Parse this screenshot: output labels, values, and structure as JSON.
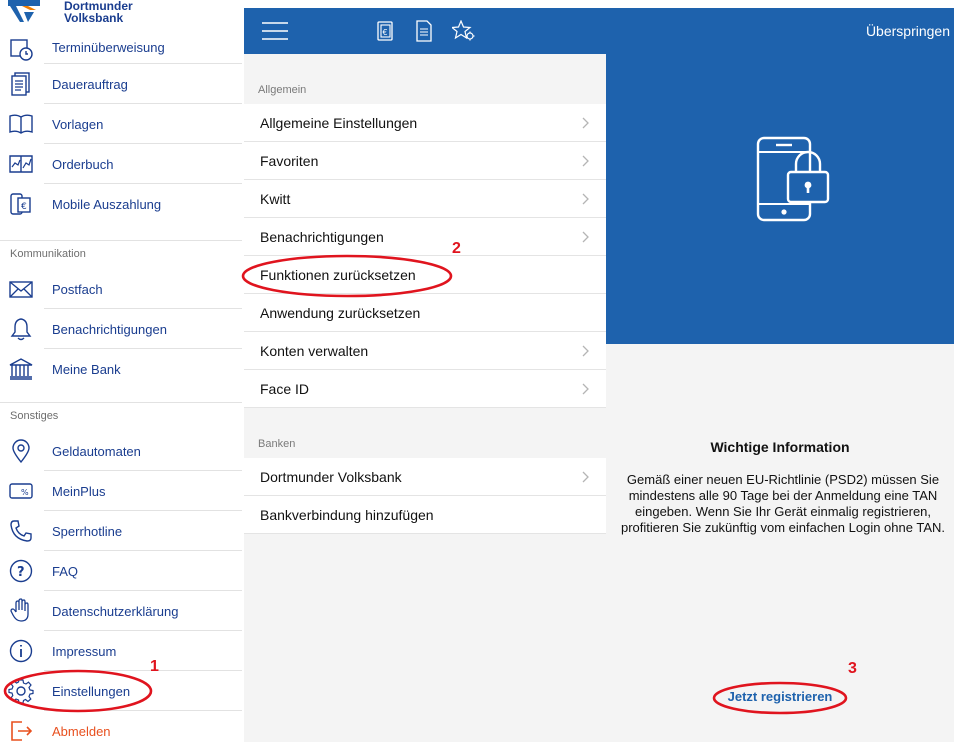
{
  "brand": {
    "line1": "Dortmunder",
    "line2": "Volksbank"
  },
  "sidebar": {
    "items_top": [
      {
        "label": "Terminüberweisung",
        "icon": "calendar-clock-icon"
      },
      {
        "label": "Dauerauftrag",
        "icon": "document-stack-icon"
      },
      {
        "label": "Vorlagen",
        "icon": "open-book-icon"
      },
      {
        "label": "Orderbuch",
        "icon": "chart-book-icon"
      },
      {
        "label": "Mobile Auszahlung",
        "icon": "phone-euro-icon"
      }
    ],
    "section_kommunikation": "Kommunikation",
    "items_komm": [
      {
        "label": "Postfach",
        "icon": "envelope-icon"
      },
      {
        "label": "Benachrichtigungen",
        "icon": "bell-icon"
      },
      {
        "label": "Meine Bank",
        "icon": "bank-building-icon"
      }
    ],
    "section_sonstiges": "Sonstiges",
    "items_sonst": [
      {
        "label": "Geldautomaten",
        "icon": "map-pin-icon"
      },
      {
        "label": "MeinPlus",
        "icon": "percent-card-icon"
      },
      {
        "label": "Sperrhotline",
        "icon": "phone-handset-icon"
      },
      {
        "label": "FAQ",
        "icon": "question-circle-icon"
      },
      {
        "label": "Datenschutzerklärung",
        "icon": "hand-icon"
      },
      {
        "label": "Impressum",
        "icon": "info-circle-icon"
      },
      {
        "label": "Einstellungen",
        "icon": "gear-icon"
      },
      {
        "label": "Abmelden",
        "icon": "logout-icon"
      }
    ]
  },
  "topbar": {
    "skip_label": "Überspringen"
  },
  "settings": {
    "section_allgemein": "Allgemein",
    "allgemein": [
      {
        "label": "Allgemeine Einstellungen",
        "chevron": true
      },
      {
        "label": "Favoriten",
        "chevron": true
      },
      {
        "label": "Kwitt",
        "chevron": true
      },
      {
        "label": "Benachrichtigungen",
        "chevron": true
      },
      {
        "label": "Funktionen zurücksetzen",
        "chevron": false
      },
      {
        "label": "Anwendung zurücksetzen",
        "chevron": false
      },
      {
        "label": "Konten verwalten",
        "chevron": true
      },
      {
        "label": "Face ID",
        "chevron": true
      }
    ],
    "section_banken": "Banken",
    "banken": [
      {
        "label": "Dortmunder Volksbank",
        "chevron": true
      },
      {
        "label": "Bankverbindung hinzufügen",
        "chevron": false
      }
    ]
  },
  "info": {
    "title": "Wichtige Information",
    "body": "Gemäß einer neuen EU-Richtlinie (PSD2) müssen Sie mindestens alle 90 Tage bei der Anmeldung eine TAN eingeben. Wenn Sie Ihr Gerät einmalig registrieren, profitieren Sie zukünftig vom einfachen Login ohne TAN.",
    "register_label": "Jetzt registrieren"
  },
  "annotations": {
    "step1": "1",
    "step2": "2",
    "step3": "3"
  },
  "colors": {
    "brand_blue": "#1e62ad",
    "link_blue": "#1a3d8f",
    "logout_orange": "#e8501f",
    "annotation_red": "#e0141e"
  }
}
